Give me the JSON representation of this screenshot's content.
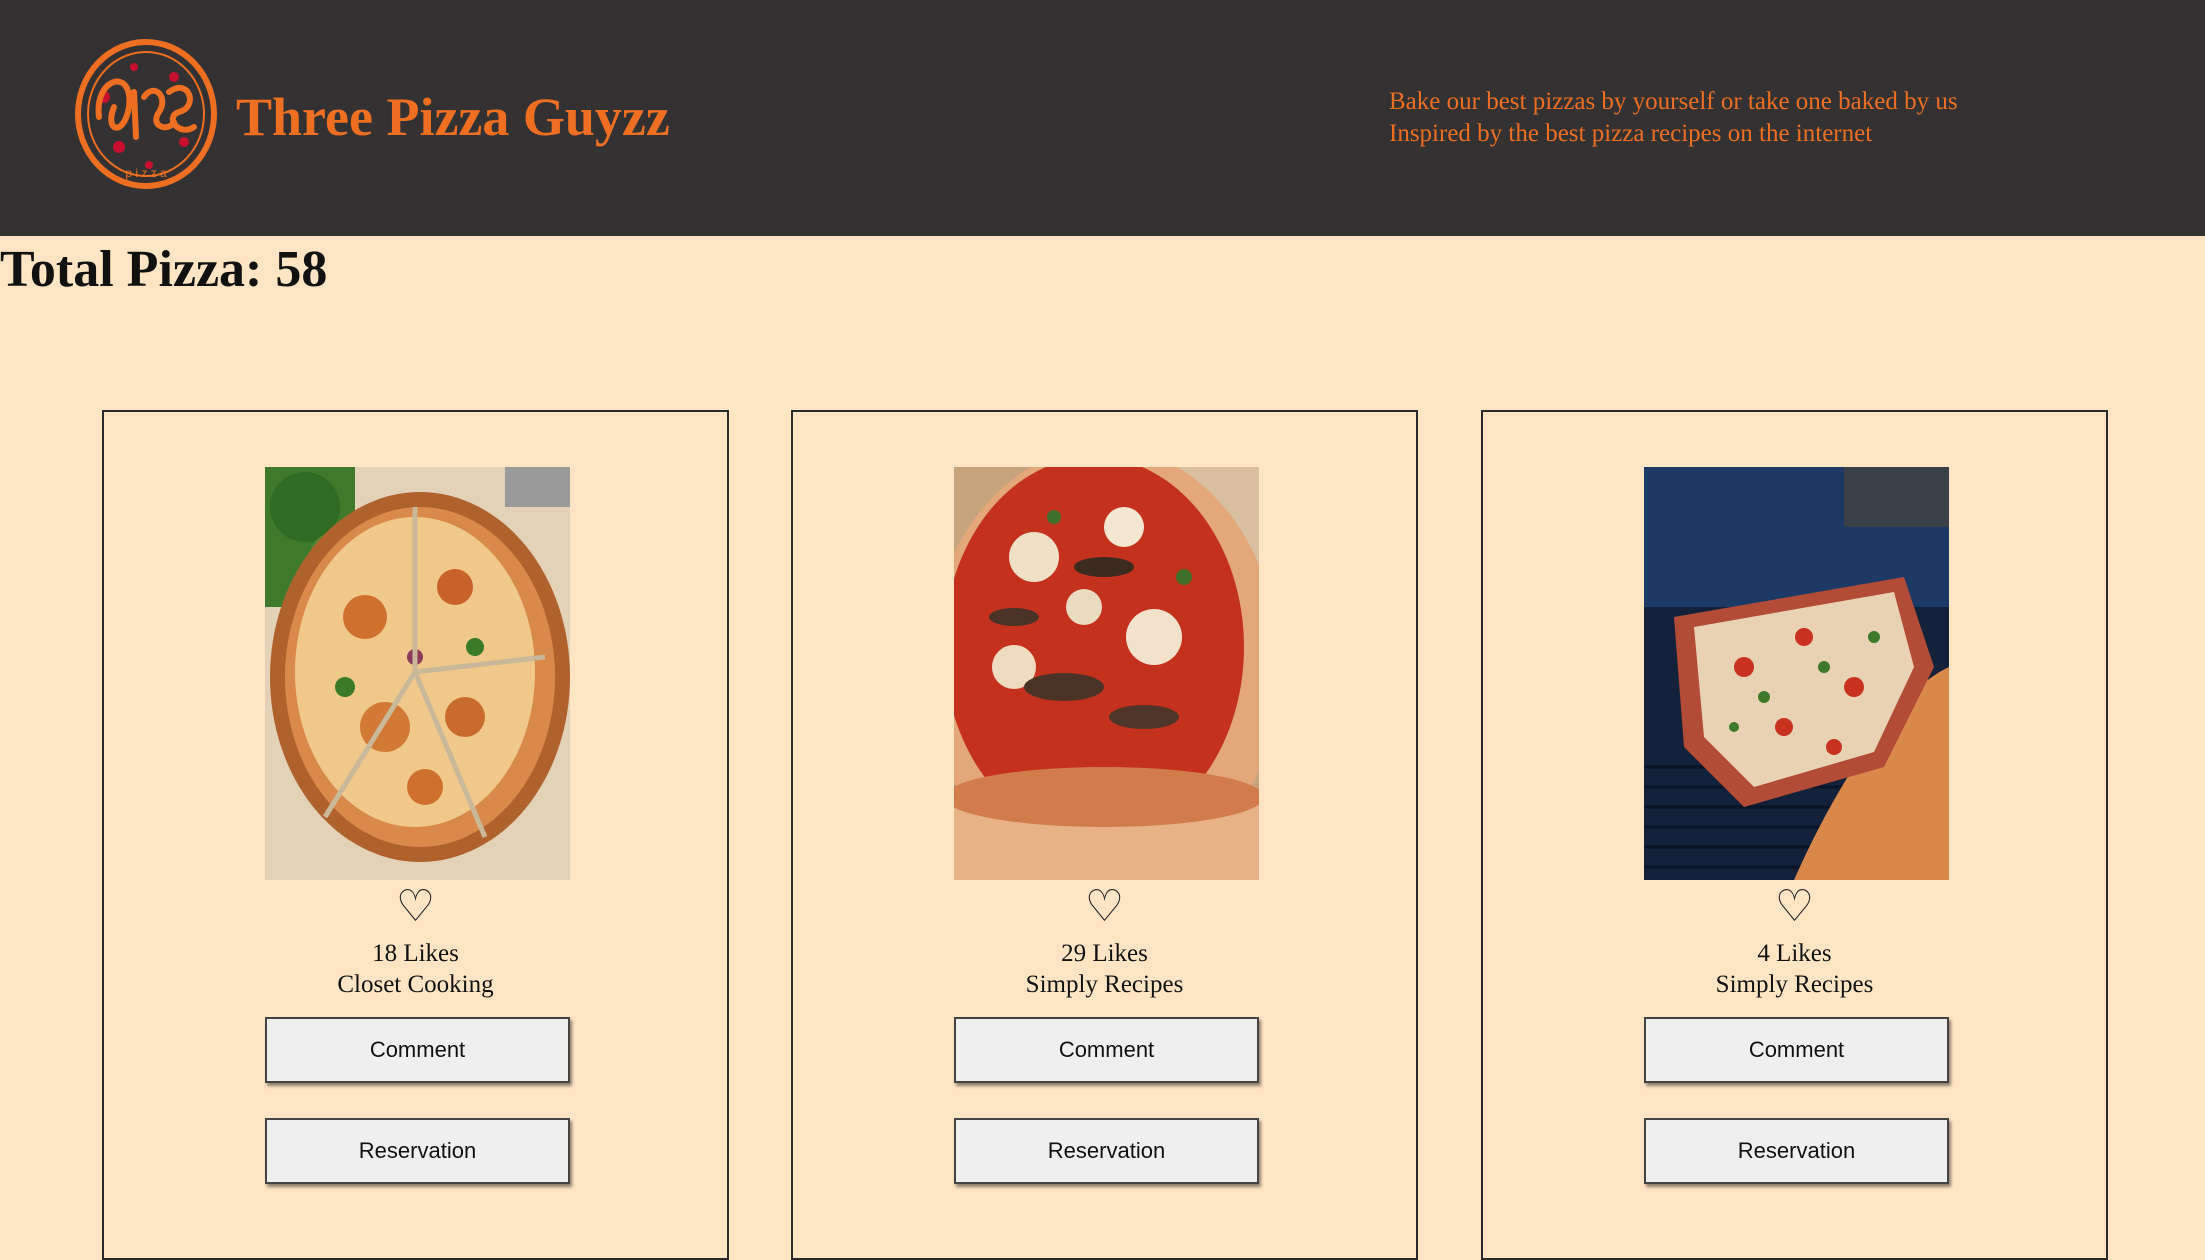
{
  "header": {
    "logo_icon": "pizza-logo-icon",
    "title": "Three Pizza Guyzz",
    "tagline_line1": "Bake our best pizzas by yourself or take one baked by us",
    "tagline_line2": "Inspired by the best pizza recipes on the internet",
    "brand_color": "#ee6f22",
    "background_color": "#333131"
  },
  "summary": {
    "total_label": "Total Pizza: 58"
  },
  "page": {
    "background_color": "#ffe5c4"
  },
  "cards": [
    {
      "image": "cauliflower-crust-pizza-photo",
      "heart_icon": "♡",
      "likes": "18 Likes",
      "source": "Closet Cooking",
      "comment_label": "Comment",
      "reservation_label": "Reservation"
    },
    {
      "image": "mushroom-pizza-photo",
      "heart_icon": "♡",
      "likes": "29 Likes",
      "source": "Simply Recipes",
      "comment_label": "Comment",
      "reservation_label": "Reservation"
    },
    {
      "image": "grilled-pizza-photo",
      "heart_icon": "♡",
      "likes": "4 Likes",
      "source": "Simply Recipes",
      "comment_label": "Comment",
      "reservation_label": "Reservation"
    }
  ]
}
